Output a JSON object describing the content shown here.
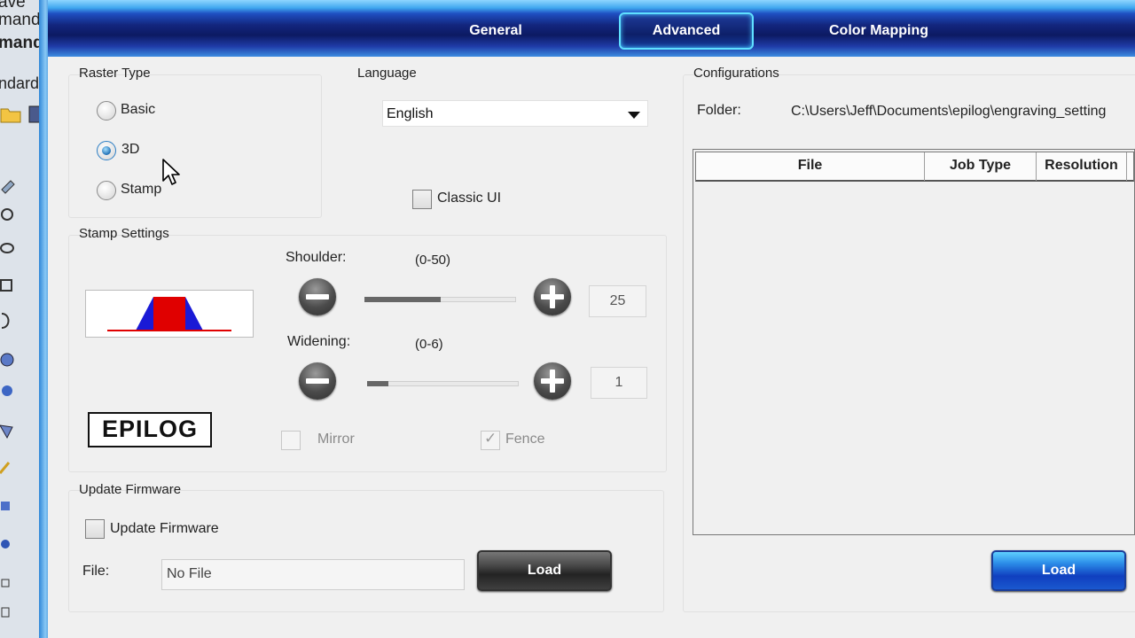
{
  "background_app": {
    "fragments": [
      "ave",
      "mand",
      "mand",
      "ndard"
    ]
  },
  "tabs": [
    {
      "label": "General",
      "active": false
    },
    {
      "label": "Advanced",
      "active": true
    },
    {
      "label": "Color Mapping",
      "active": false
    }
  ],
  "raster_type": {
    "title": "Raster Type",
    "options": [
      {
        "label": "Basic",
        "checked": false
      },
      {
        "label": "3D",
        "checked": true
      },
      {
        "label": "Stamp",
        "checked": false
      }
    ]
  },
  "language": {
    "title": "Language",
    "selected": "English",
    "classic_ui_label": "Classic UI",
    "classic_ui_checked": false
  },
  "stamp_settings": {
    "title": "Stamp Settings",
    "logo_text": "EPILOG",
    "shoulder": {
      "label": "Shoulder:",
      "range": "(0-50)",
      "value": "25",
      "min": 0,
      "max": 50,
      "fraction": 0.5
    },
    "widening": {
      "label": "Widening:",
      "range": "(0-6)",
      "value": "1",
      "min": 0,
      "max": 6,
      "fraction": 0.14
    },
    "mirror_label": "Mirror",
    "mirror_checked": false,
    "fence_label": "Fence",
    "fence_checked": true,
    "preview_colors": {
      "center": "#e00000",
      "shoulders": "#1a1ad6",
      "baseline": "#e00000"
    }
  },
  "update_firmware": {
    "title": "Update Firmware",
    "checkbox_label": "Update Firmware",
    "checked": false,
    "file_label": "File:",
    "file_value": "No File",
    "load_label": "Load"
  },
  "configurations": {
    "title": "Configurations",
    "folder_label": "Folder:",
    "folder_value": "C:\\Users\\Jeff\\Documents\\epilog\\engraving_setting",
    "columns": [
      "File",
      "Job Type",
      "Resolution"
    ],
    "rows": [],
    "load_label": "Load"
  }
}
